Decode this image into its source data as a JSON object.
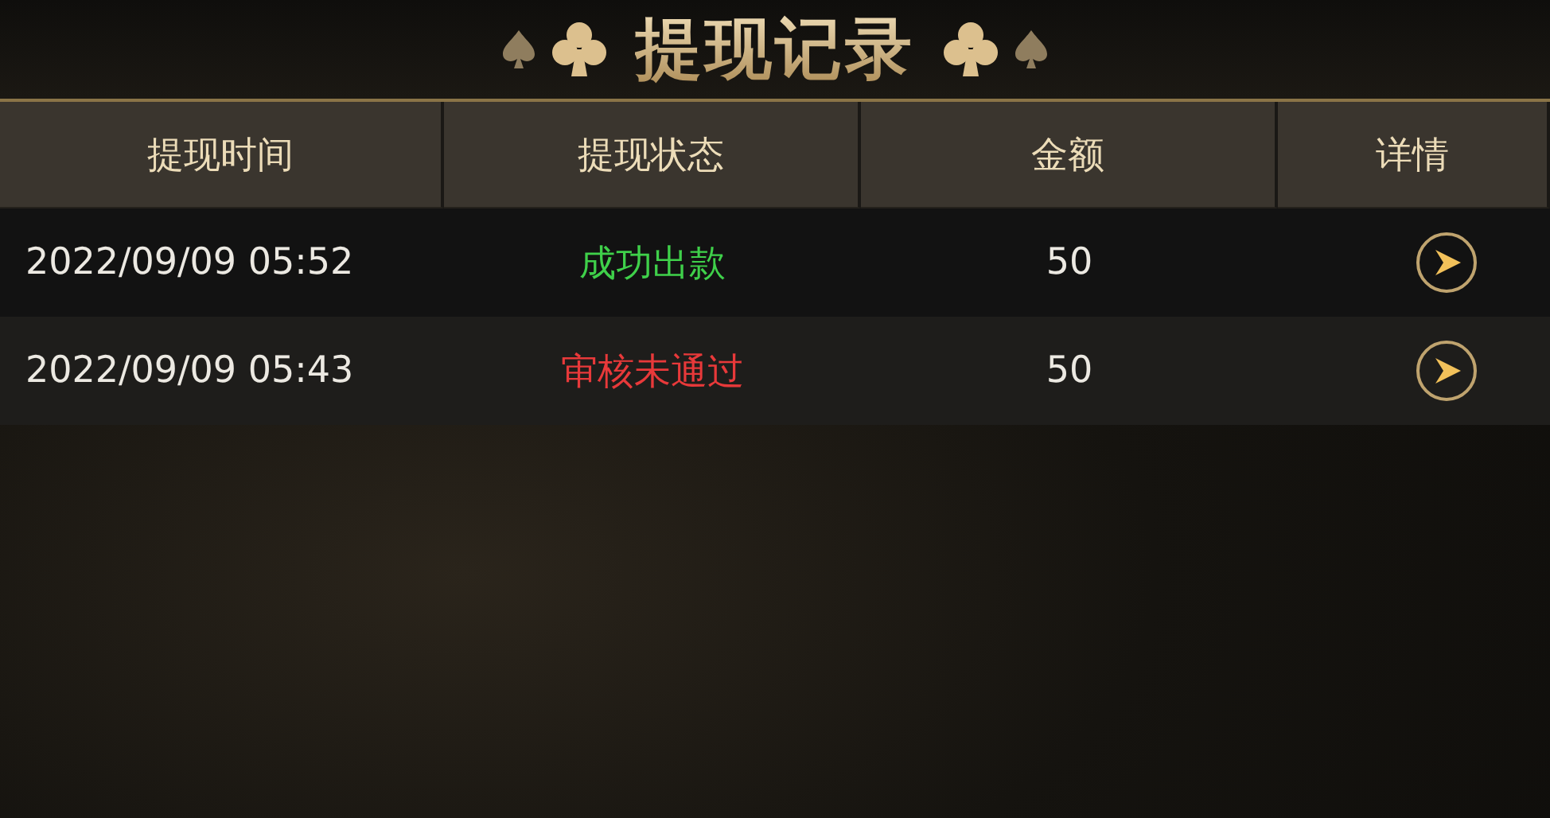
{
  "header": {
    "title": "提现记录"
  },
  "table": {
    "columns": [
      "提现时间",
      "提现状态",
      "金额",
      "详情"
    ],
    "rows": [
      {
        "time": "2022/09/09 05:52",
        "status": "成功出款",
        "color": "#3fd04a",
        "amount": "50"
      },
      {
        "time": "2022/09/09 05:43",
        "status": "审核未通过",
        "color": "#e8393a",
        "amount": "50"
      }
    ]
  }
}
